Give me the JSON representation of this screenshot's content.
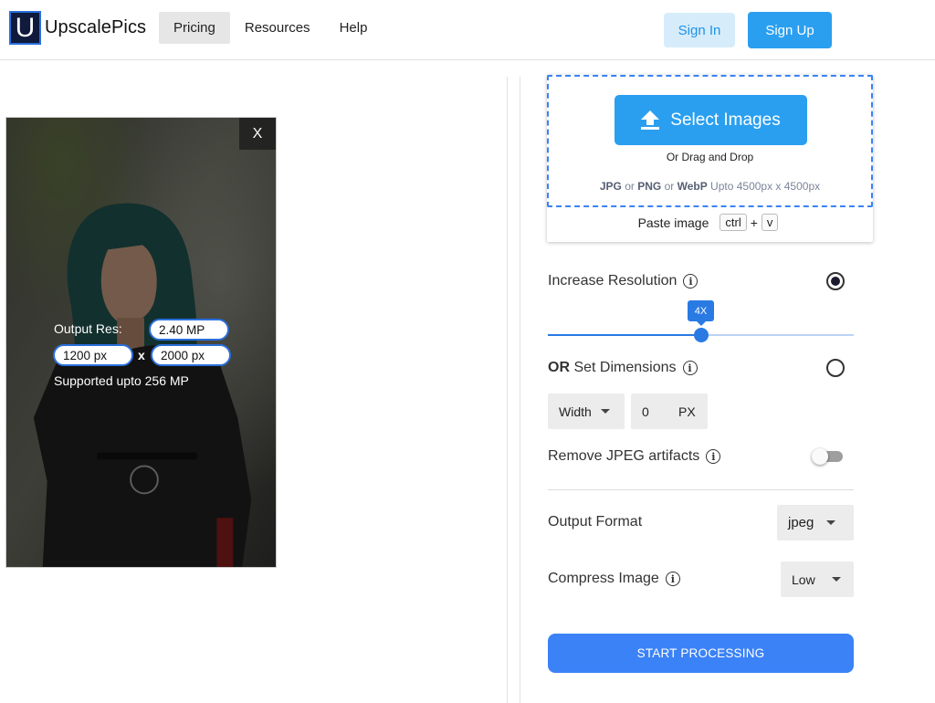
{
  "header": {
    "logo_letter": "U",
    "logo_text": "UpscalePics",
    "nav": [
      "Pricing",
      "Resources",
      "Help"
    ],
    "sign_in": "Sign In",
    "sign_up": "Sign Up"
  },
  "preview": {
    "close_label": "X",
    "output_res_label": "Output Res:",
    "megapixels": "2.40 MP",
    "width_value": "1200 px",
    "separator": "x",
    "height_value": "2000 px",
    "support_text": "Supported upto 256 MP"
  },
  "upload": {
    "select_label": "Select Images",
    "drag_text": "Or Drag and Drop",
    "formats": {
      "jpg": "JPG",
      "or1": " or ",
      "png": "PNG",
      "or2": " or ",
      "webp": "WebP",
      "limit": " Upto 4500px x 4500px"
    },
    "paste_label": "Paste image",
    "key_ctrl": "ctrl",
    "plus": "+",
    "key_v": "v"
  },
  "settings": {
    "increase_resolution": {
      "label": "Increase Resolution",
      "selected": true,
      "slider_value": "4X",
      "slider_fraction": 0.5
    },
    "set_dimensions": {
      "label_bold": "OR",
      "label_rest": " Set Dimensions",
      "selected": false,
      "dimension": "Width",
      "value": "0",
      "unit": "PX"
    },
    "remove_jpeg": {
      "label": "Remove JPEG artifacts",
      "enabled": false
    },
    "output_format": {
      "label": "Output Format",
      "value": "jpeg"
    },
    "compress": {
      "label": "Compress Image",
      "value": "Low"
    },
    "start_label": "START PROCESSING"
  },
  "colors": {
    "accent": "#2a9ff0",
    "primary_button": "#3b82f6",
    "slider": "#2a7ae4"
  }
}
